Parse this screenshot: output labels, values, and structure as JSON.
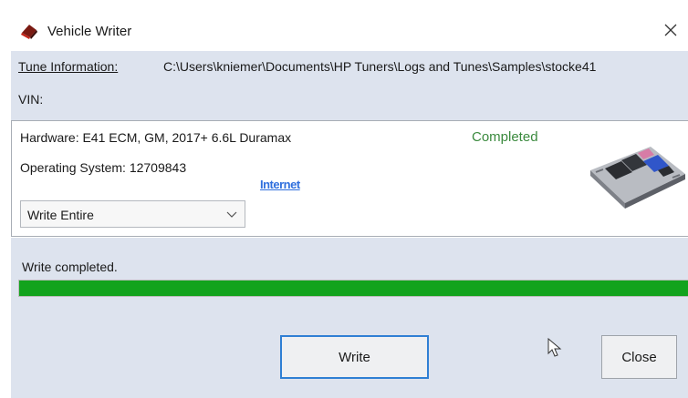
{
  "window": {
    "title": "Vehicle Writer",
    "icon": "vehicle-writer-app-icon",
    "close_icon": "close-icon"
  },
  "tune_info": {
    "label": "Tune Information:",
    "path": "C:\\Users\\kniemer\\Documents\\HP Tuners\\Logs and Tunes\\Samples\\stocke41",
    "vin_label": "VIN:"
  },
  "hardware": {
    "hardware_text": "Hardware: E41 ECM, GM, 2017+ 6.6L Duramax",
    "os_text": "Operating System: 12709843",
    "status": "Completed",
    "internet_link": "Internet",
    "write_mode": "Write Entire",
    "image_icon": "ecm-module-icon"
  },
  "progress": {
    "message": "Write completed.",
    "percent": 100
  },
  "buttons": {
    "write_label": "Write",
    "close_label": "Close"
  },
  "colors": {
    "status_green": "#3b8a3e",
    "progress_green": "#12a31d",
    "link_blue": "#2f6fdd",
    "panel_blue": "#dde3ee",
    "focus_border": "#2f7fd4"
  }
}
